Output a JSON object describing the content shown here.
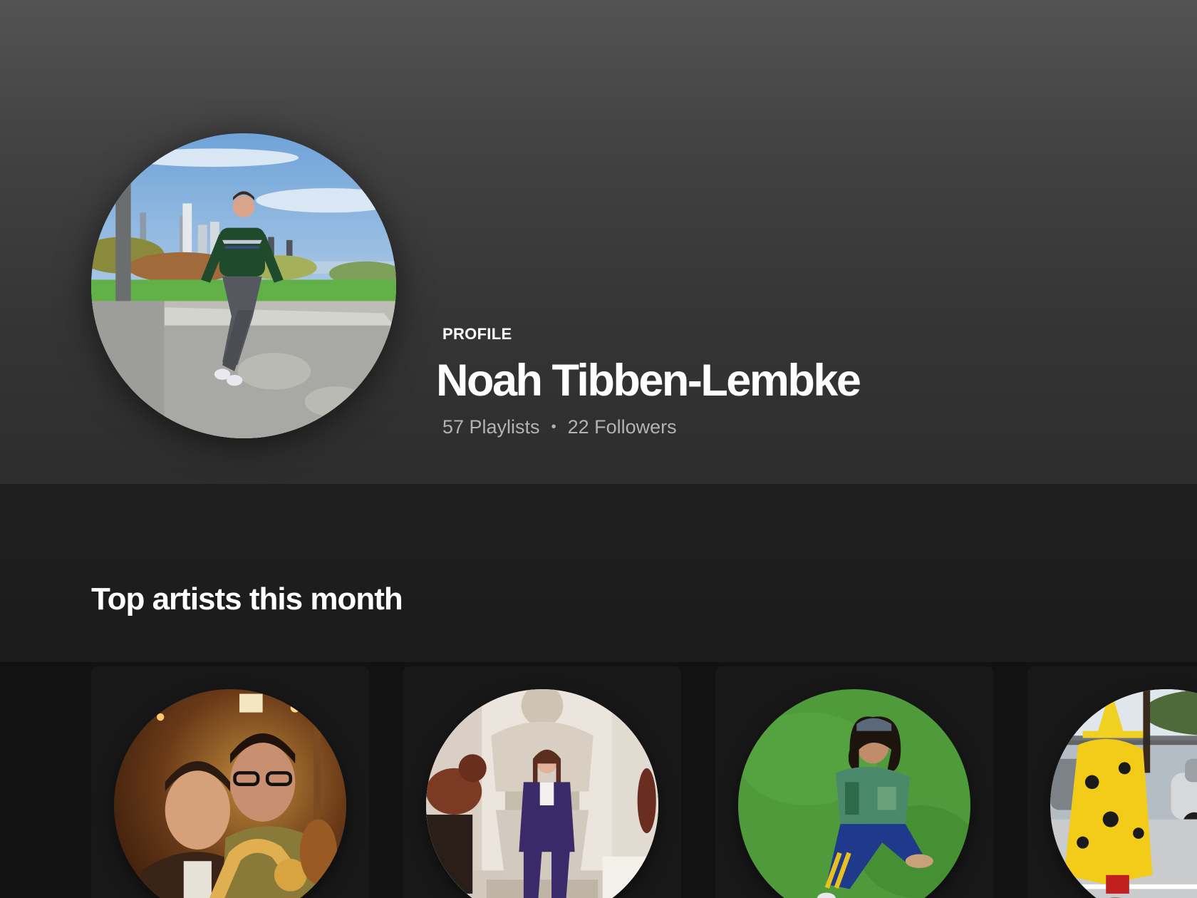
{
  "profile": {
    "type_label": "PROFILE",
    "name": "Noah Tibben-Lembke",
    "playlists": "57 Playlists",
    "separator": "•",
    "followers": "22 Followers",
    "avatar_icon": "profile-photo"
  },
  "top_artists": {
    "title": "Top artists this month",
    "items": [
      {
        "image_icon": "artist-photo-duo-saxophone"
      },
      {
        "image_icon": "artist-photo-museum"
      },
      {
        "image_icon": "artist-photo-grass"
      },
      {
        "image_icon": "artist-photo-street-yellow-costume"
      }
    ]
  },
  "colors": {
    "background": "#181818",
    "header_top": "#535353",
    "header_bottom": "#2d2d2d",
    "text_primary": "#ffffff",
    "text_secondary": "#b3b3b3",
    "card_bg": "#181818"
  }
}
